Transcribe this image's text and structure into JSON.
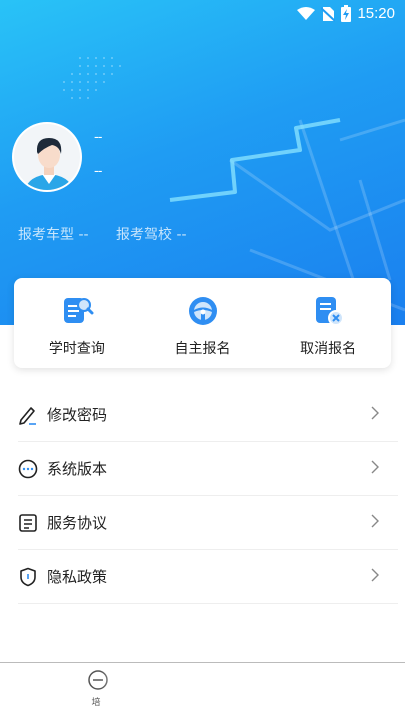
{
  "status_bar": {
    "time": "15:20",
    "icons": [
      "wifi-icon",
      "no-sim-icon",
      "battery-charging-icon"
    ]
  },
  "profile": {
    "name": "--",
    "id_number": "--",
    "license_type_label": "报考车型 --",
    "driving_school_label": "报考驾校 --"
  },
  "quick_actions": [
    {
      "label": "学时查询",
      "icon": "hours-query-icon"
    },
    {
      "label": "自主报名",
      "icon": "steering-wheel-icon"
    },
    {
      "label": "取消报名",
      "icon": "cancel-registration-icon"
    }
  ],
  "menu": [
    {
      "label": "修改密码",
      "icon": "edit-password-icon"
    },
    {
      "label": "系统版本",
      "icon": "system-version-icon"
    },
    {
      "label": "服务协议",
      "icon": "service-agreement-icon"
    },
    {
      "label": "隐私政策",
      "icon": "privacy-policy-icon"
    }
  ],
  "bottom_nav": {
    "items": [
      {
        "label": "培",
        "icon": "training-icon"
      }
    ]
  },
  "colors": {
    "hero_start": "#29c3f7",
    "hero_end": "#1a7fef",
    "accent": "#1f8cf0"
  }
}
